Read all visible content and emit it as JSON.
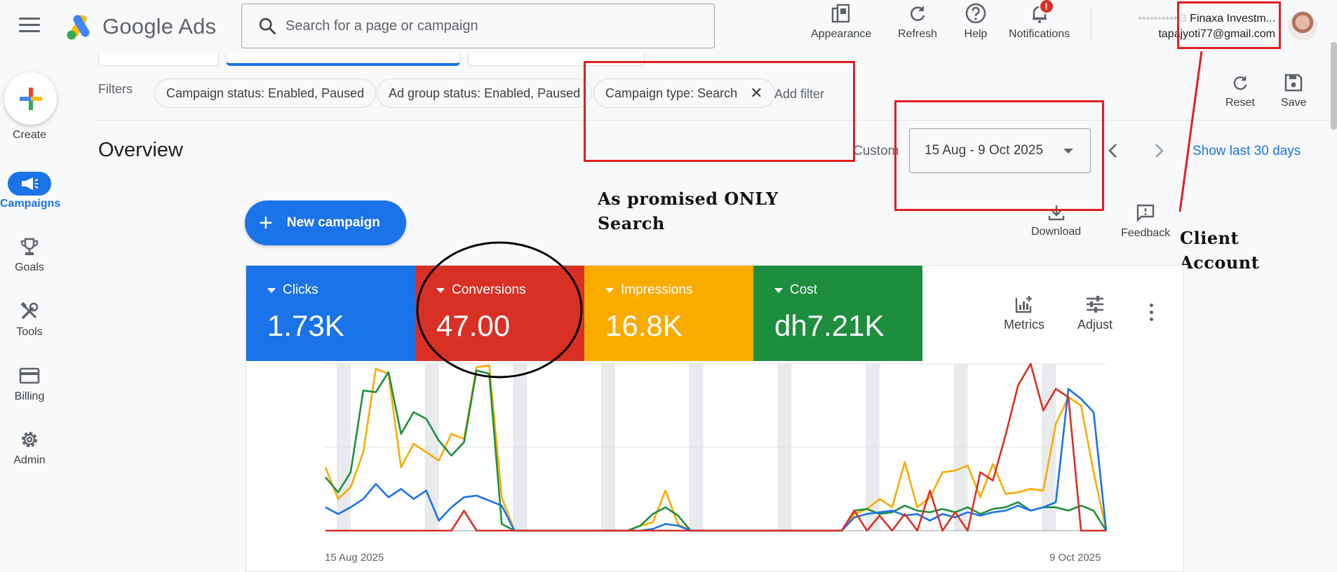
{
  "app": {
    "name": "Google Ads"
  },
  "search": {
    "placeholder": "Search for a page or campaign"
  },
  "toolbar": {
    "appearance": "Appearance",
    "refresh": "Refresh",
    "help": "Help",
    "notifications": "Notifications",
    "notification_badge": "!"
  },
  "account": {
    "name_line": "Finaxa Investm...",
    "name_prefix_blurred": "•••••••••• 3",
    "email": "tapajyoti77@gmail.com"
  },
  "sidenav": {
    "create": "Create",
    "items": [
      {
        "label": "Campaigns",
        "icon": "megaphone-icon",
        "active": true
      },
      {
        "label": "Goals",
        "icon": "trophy-icon"
      },
      {
        "label": "Tools",
        "icon": "tools-icon"
      },
      {
        "label": "Billing",
        "icon": "credit-card-icon"
      },
      {
        "label": "Admin",
        "icon": "gear-icon"
      }
    ]
  },
  "filters": {
    "label": "Filters",
    "chips": [
      "Campaign status: Enabled, Paused",
      "Ad group status: Enabled, Paused",
      "Campaign type: Search"
    ],
    "add_filter": "Add filter",
    "reset": "Reset",
    "save": "Save"
  },
  "overview": {
    "title": "Overview",
    "custom_label": "Custom",
    "date_range": "15 Aug - 9 Oct 2025",
    "show_last": "Show last 30 days",
    "new_campaign": "New campaign",
    "download": "Download",
    "feedback": "Feedback"
  },
  "annotations": {
    "search_note_line1": "As promised ONLY",
    "search_note_line2": "Search",
    "client_line1": "Client",
    "client_line2": "Account"
  },
  "metrics": [
    {
      "name": "Clicks",
      "value": "1.73K",
      "color": "#1a73e8"
    },
    {
      "name": "Conversions",
      "value": "47.00",
      "color": "#d93025"
    },
    {
      "name": "Impressions",
      "value": "16.8K",
      "color": "#f9ab00"
    },
    {
      "name": "Cost",
      "value": "dh7.21K",
      "color": "#1e8e3e"
    }
  ],
  "card_tools": {
    "metrics": "Metrics",
    "adjust": "Adjust"
  },
  "chart_data": {
    "type": "line",
    "x_start_label": "15 Aug 2025",
    "x_end_label": "9 Oct 2025",
    "grid": true,
    "weekend_bands": true,
    "series": [
      {
        "metric": "Impressions",
        "color": "#f9ab00",
        "values": [
          0.38,
          0.19,
          0.26,
          0.47,
          0.97,
          0.94,
          0.38,
          0.52,
          0.47,
          0.42,
          0.58,
          0.55,
          0.98,
          0.99,
          0.2,
          0.0,
          0.0,
          0.0,
          0.0,
          0.0,
          0.0,
          0.0,
          0.0,
          0.0,
          0.0,
          0.03,
          0.05,
          0.24,
          0.04,
          0.0,
          0.0,
          0.0,
          0.0,
          0.0,
          0.0,
          0.0,
          0.0,
          0.0,
          0.0,
          0.0,
          0.0,
          0.0,
          0.1,
          0.13,
          0.19,
          0.14,
          0.41,
          0.14,
          0.2,
          0.35,
          0.36,
          0.39,
          0.2,
          0.4,
          0.22,
          0.23,
          0.25,
          0.24,
          0.64,
          0.8,
          0.75,
          0.35,
          0.0
        ]
      },
      {
        "metric": "Cost",
        "color": "#1e8e3e",
        "values": [
          0.32,
          0.23,
          0.35,
          0.84,
          0.83,
          0.95,
          0.58,
          0.71,
          0.67,
          0.54,
          0.45,
          0.53,
          0.96,
          0.94,
          0.04,
          0.0,
          0.0,
          0.0,
          0.0,
          0.0,
          0.0,
          0.0,
          0.0,
          0.0,
          0.0,
          0.03,
          0.1,
          0.14,
          0.09,
          0.0,
          0.0,
          0.0,
          0.0,
          0.0,
          0.0,
          0.0,
          0.0,
          0.0,
          0.0,
          0.0,
          0.0,
          0.0,
          0.12,
          0.13,
          0.1,
          0.11,
          0.15,
          0.12,
          0.11,
          0.13,
          0.11,
          0.14,
          0.1,
          0.13,
          0.14,
          0.17,
          0.12,
          0.14,
          0.14,
          0.12,
          0.15,
          0.12,
          0.0
        ]
      },
      {
        "metric": "Clicks",
        "color": "#1a73e8",
        "values": [
          0.14,
          0.1,
          0.14,
          0.19,
          0.28,
          0.2,
          0.25,
          0.19,
          0.24,
          0.06,
          0.14,
          0.2,
          0.21,
          0.18,
          0.15,
          0.0,
          0.0,
          0.0,
          0.0,
          0.0,
          0.0,
          0.0,
          0.0,
          0.0,
          0.0,
          0.0,
          0.01,
          0.04,
          0.03,
          0.0,
          0.0,
          0.0,
          0.0,
          0.0,
          0.0,
          0.0,
          0.0,
          0.0,
          0.0,
          0.0,
          0.0,
          0.0,
          0.08,
          0.1,
          0.11,
          0.12,
          0.09,
          0.1,
          0.06,
          0.1,
          0.08,
          0.11,
          0.09,
          0.11,
          0.12,
          0.15,
          0.12,
          0.14,
          0.17,
          0.85,
          0.79,
          0.71,
          0.0
        ]
      },
      {
        "metric": "Conversions",
        "color": "#d93025",
        "values": [
          0.0,
          0.0,
          0.0,
          0.0,
          0.0,
          0.0,
          0.0,
          0.0,
          0.0,
          0.0,
          0.0,
          0.12,
          0.0,
          0.0,
          0.0,
          0.0,
          0.0,
          0.0,
          0.0,
          0.0,
          0.0,
          0.0,
          0.0,
          0.0,
          0.0,
          0.0,
          0.0,
          0.0,
          0.0,
          0.0,
          0.0,
          0.0,
          0.0,
          0.0,
          0.0,
          0.0,
          0.0,
          0.0,
          0.0,
          0.0,
          0.0,
          0.0,
          0.12,
          0.0,
          0.09,
          0.0,
          0.1,
          0.0,
          0.24,
          0.0,
          0.11,
          0.0,
          0.35,
          0.3,
          0.57,
          0.87,
          1.0,
          0.72,
          0.85,
          0.8,
          0.0,
          0.0,
          0.0
        ]
      }
    ]
  }
}
